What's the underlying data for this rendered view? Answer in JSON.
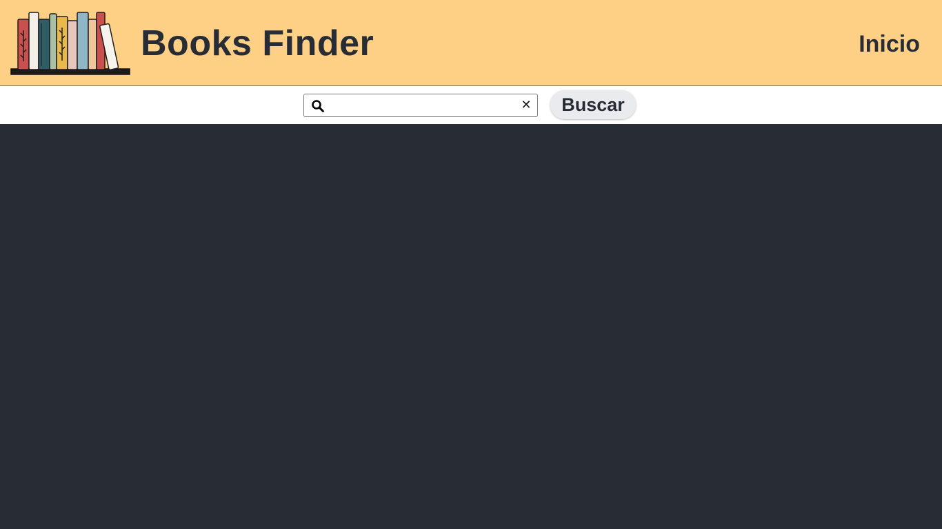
{
  "header": {
    "title": "Books Finder",
    "nav_link": "Inicio",
    "logo_icon": "bookshelf-icon",
    "background": "#fed085",
    "text_color": "#282c34"
  },
  "search": {
    "placeholder": "",
    "value": "",
    "search_icon": "search-icon",
    "clear_icon": "close-icon",
    "clear_glyph": "✕",
    "button_label": "Buscar"
  },
  "main": {
    "background": "#282c34"
  }
}
